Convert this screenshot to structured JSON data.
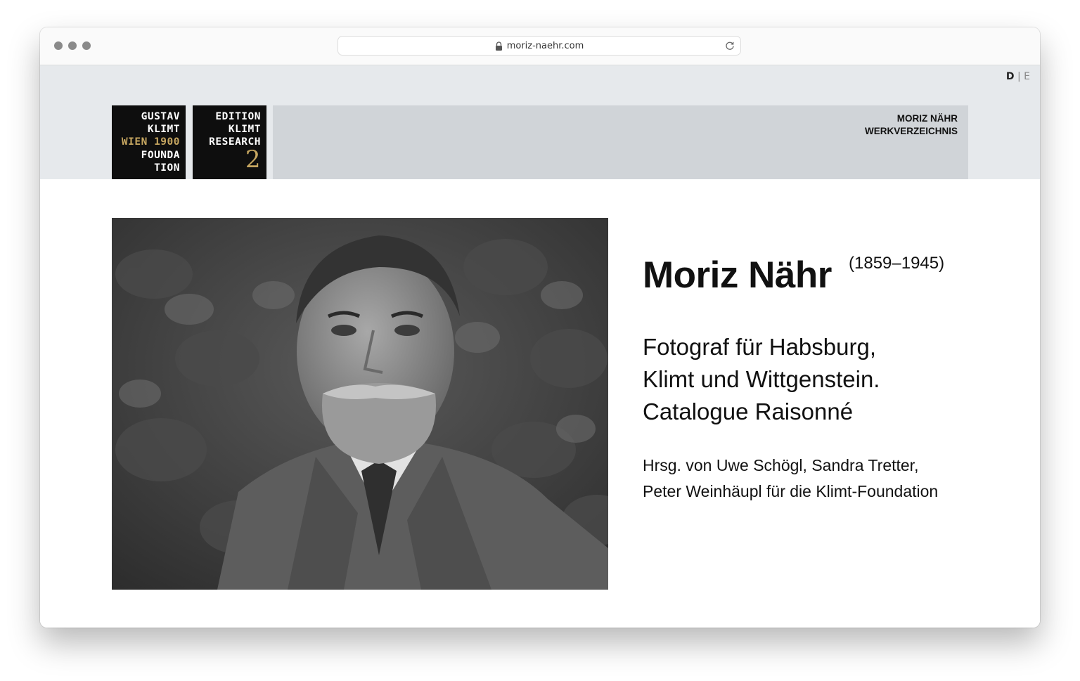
{
  "browser": {
    "url": "moriz-naehr.com"
  },
  "language_switch": {
    "active": "D",
    "separator": "|",
    "inactive": "E"
  },
  "logos": {
    "foundation": {
      "line1": "GUSTAV",
      "line2": "KLIMT",
      "line3": "WIEN 1900",
      "line4": "FOUNDA",
      "line5": "TION"
    },
    "edition": {
      "line1": "EDITION",
      "line2": "KLIMT",
      "line3": "RESEARCH",
      "number": "2"
    }
  },
  "site_title": {
    "line1": "MORIZ NÄHR",
    "line2": "WERKVERZEICHNIS"
  },
  "hero": {
    "name": "Moriz Nähr",
    "years": "(1859–1945)",
    "subtitle_line1": "Fotograf für Habsburg,",
    "subtitle_line2": "Klimt und Wittgenstein.",
    "subtitle_line3": "Catalogue Raisonné",
    "editors": "Hrsg. von Uwe Schögl, Sandra Tretter, Peter Weinhäupl für die Klimt-Foundation"
  },
  "icons": [
    "lock-icon",
    "reload-icon"
  ],
  "colors": {
    "header_band": "#e6e9ec",
    "title_panel": "#d0d4d8",
    "logo_black": "#0e0e0e",
    "logo_gold": "#c6a660"
  }
}
